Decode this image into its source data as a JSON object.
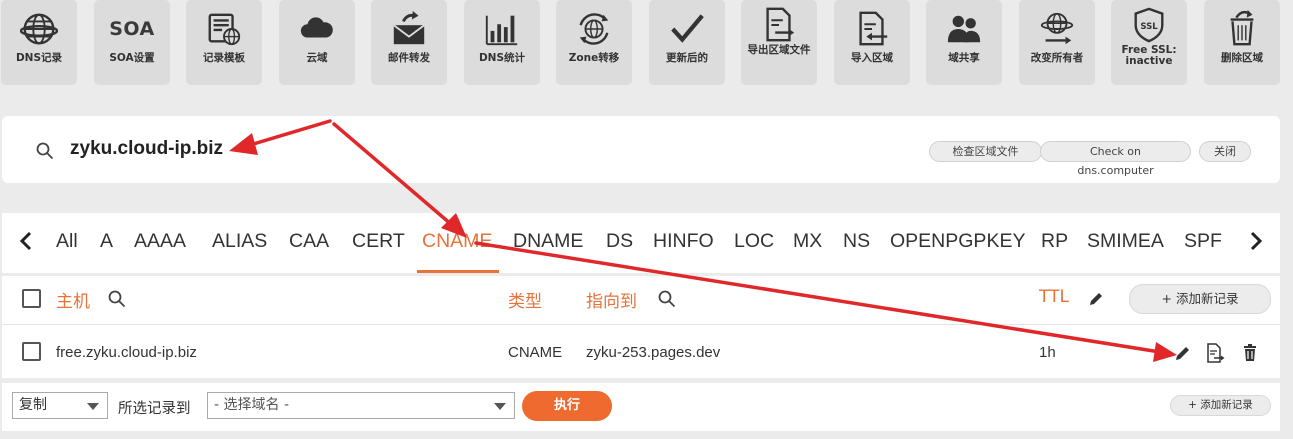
{
  "toolbar": {
    "items": [
      {
        "label": "DNS记录",
        "icon": "globe-icon"
      },
      {
        "label": "SOA设置",
        "icon": "soa-text-icon",
        "icon_text": "SOA"
      },
      {
        "label": "记录模板",
        "icon": "template-icon"
      },
      {
        "label": "云域",
        "icon": "cloud-icon"
      },
      {
        "label": "邮件转发",
        "icon": "mail-forward-icon"
      },
      {
        "label": "DNS统计",
        "icon": "bar-chart-icon"
      },
      {
        "label": "Zone转移",
        "icon": "globe-transfer-icon"
      },
      {
        "label": "更新后的",
        "icon": "checkmark-icon"
      },
      {
        "label": "导出区域文件",
        "icon": "export-file-icon"
      },
      {
        "label": "导入区域",
        "icon": "import-file-icon"
      },
      {
        "label": "域共享",
        "icon": "users-icon"
      },
      {
        "label": "改变所有者",
        "icon": "change-owner-icon"
      },
      {
        "label": "Free SSL: inactive",
        "icon": "ssl-shield-icon",
        "icon_text": "SSL"
      },
      {
        "label": "删除区域",
        "icon": "trash-bin-icon"
      }
    ]
  },
  "search": {
    "domain": "zyku.cloud-ip.biz",
    "buttons": [
      "检查区域文件",
      "Check on dns.computer",
      "关闭"
    ]
  },
  "tabs": {
    "items": [
      "All",
      "A",
      "AAAA",
      "ALIAS",
      "CAA",
      "CERT",
      "CNAME",
      "DNAME",
      "DS",
      "HINFO",
      "LOC",
      "MX",
      "NS",
      "OPENPGPKEY",
      "RP",
      "SMIMEA",
      "SPF"
    ],
    "active": "CNAME"
  },
  "table": {
    "headers": {
      "host": "主机",
      "type": "类型",
      "points_to": "指向到",
      "ttl": "TTL"
    },
    "add_record": "+ 添加新记录",
    "rows": [
      {
        "host": "free.zyku.cloud-ip.biz",
        "type": "CNAME",
        "points_to": "zyku-253.pages.dev",
        "ttl": "1h"
      }
    ]
  },
  "bottom": {
    "action_select": "复制",
    "selected_to_label": "所选记录到",
    "domain_select_placeholder": "- 选择域名 -",
    "execute": "执行",
    "add_record": "+ 添加新记录"
  },
  "colors": {
    "accent": "#e5733a",
    "execute_button": "#ef6a2e",
    "annotation_arrow": "#e0282a",
    "toolbar_tile": "#dcdcdc"
  }
}
